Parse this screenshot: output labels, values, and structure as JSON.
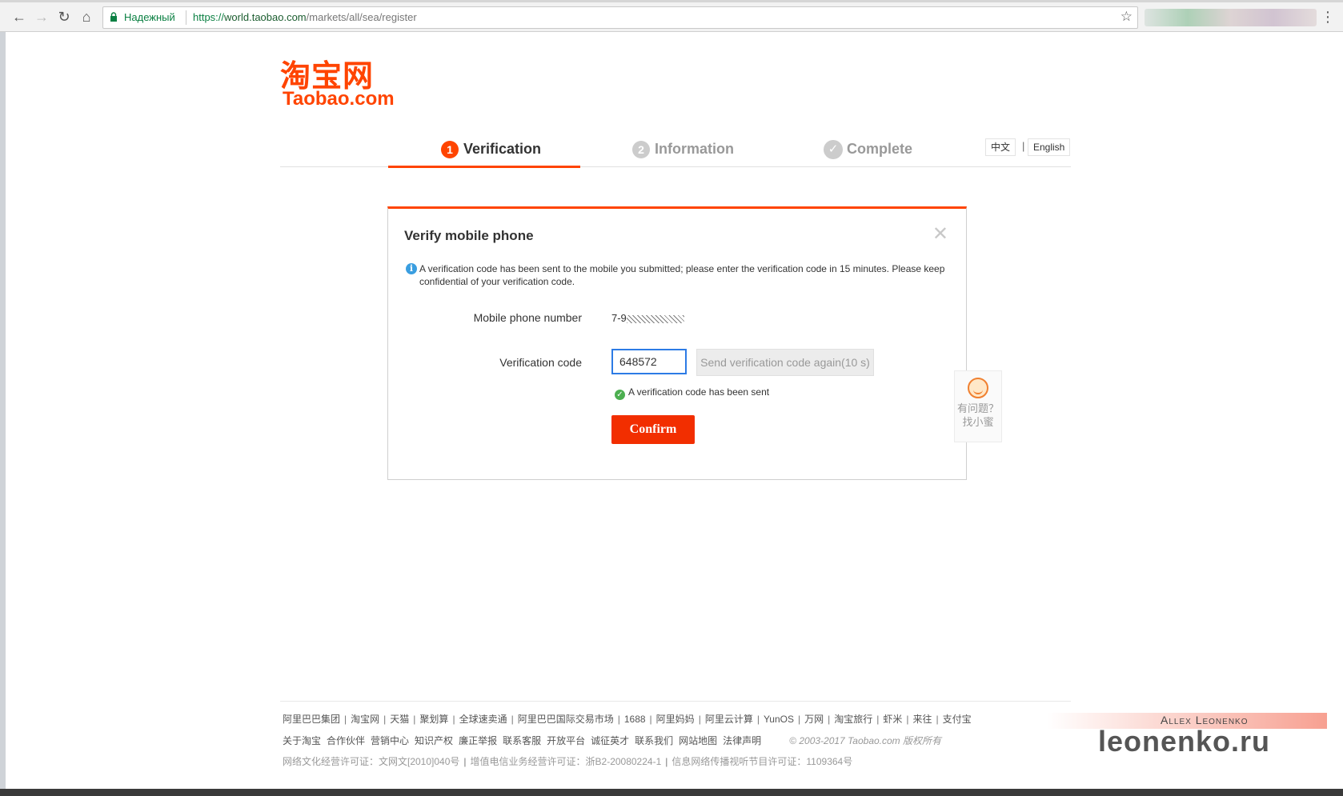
{
  "browser": {
    "secure_label": "Надежный",
    "url_scheme": "https://",
    "url_host": "world.taobao.com",
    "url_path": "/markets/all/sea/register"
  },
  "logo": {
    "cn": "淘宝网",
    "en": "Taobao.com"
  },
  "steps": [
    {
      "num": "1",
      "label": "Verification",
      "active": true
    },
    {
      "num": "2",
      "label": "Information",
      "active": false
    },
    {
      "num": "✓",
      "label": "Complete",
      "active": false
    }
  ],
  "lang": {
    "zh": "中文",
    "sep": "|",
    "en": "English"
  },
  "dialog": {
    "title": "Verify mobile phone",
    "info": "A verification code has been sent to the mobile you submitted; please enter the verification code in 15 minutes. Please keep confidential of your verification code.",
    "phone_label": "Mobile phone number",
    "phone_value": "7-9",
    "code_label": "Verification code",
    "code_value": "648572",
    "resend_label": "Send verification code again(10 s)",
    "sent_message": "A verification code has been sent",
    "confirm_label": "Confirm"
  },
  "helper": {
    "line1": "有问题？",
    "line2": "找小蜜"
  },
  "footer": {
    "row1": [
      "阿里巴巴集团",
      "淘宝网",
      "天猫",
      "聚划算",
      "全球速卖通",
      "阿里巴巴国际交易市场",
      "1688",
      "阿里妈妈",
      "阿里云计算",
      "YunOS",
      "万网",
      "淘宝旅行",
      "虾米",
      "来往",
      "支付宝"
    ],
    "row2": [
      "关于淘宝",
      "合作伙伴",
      "营销中心",
      "知识产权",
      "廉正举报",
      "联系客服",
      "开放平台",
      "诚征英才",
      "联系我们",
      "网站地图",
      "法律声明"
    ],
    "copyright": "© 2003-2017 Taobao.com 版权所有",
    "row3": [
      "网络文化经营许可证：文网文[2010]040号",
      "增值电信业务经营许可证：浙B2-20080224-1",
      "信息网络传播视听节目许可证：1109364号"
    ]
  },
  "watermark": {
    "name": "Allex Leonenko",
    "site": "leonenko.ru"
  },
  "colors": {
    "brand": "#ff4400",
    "confirm": "#f22e00",
    "input_focus": "#2d7be5",
    "success": "#4caf50",
    "info": "#3a9ee0"
  }
}
